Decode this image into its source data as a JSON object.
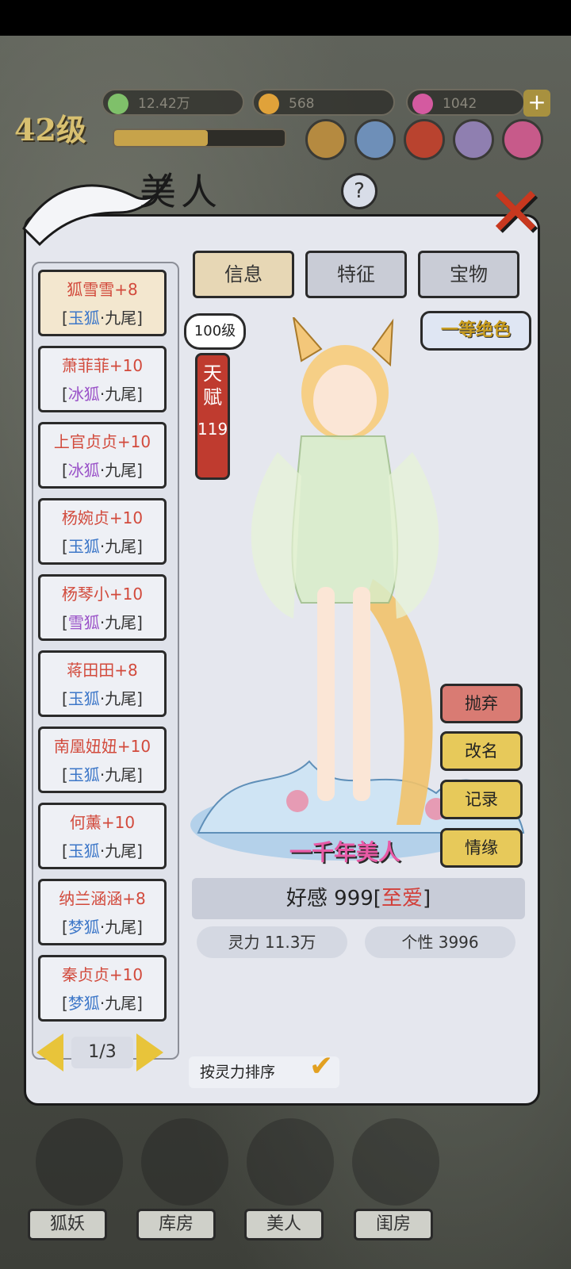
{
  "hud": {
    "level": "42级",
    "exp_progress": 0.55,
    "resources": [
      {
        "name": "spirit-stone",
        "value": "12.42万",
        "color": "#7fc06a"
      },
      {
        "name": "gold-coin",
        "value": "568",
        "color": "#e0a23a"
      },
      {
        "name": "gem",
        "value": "1042",
        "color": "#d45aa0"
      }
    ],
    "plus_label": "+"
  },
  "panel": {
    "title": "美人",
    "help_label": "?",
    "close_label": "✕"
  },
  "tabs": [
    {
      "label": "信息",
      "active": true
    },
    {
      "label": "特征",
      "active": false
    },
    {
      "label": "宝物",
      "active": false
    }
  ],
  "list": [
    {
      "name": "狐雪雪+8",
      "kind": "玉狐",
      "suffix": "·九尾]",
      "kind_color": "blue",
      "selected": true
    },
    {
      "name": "萧菲菲+10",
      "kind": "冰狐",
      "suffix": "·九尾]",
      "kind_color": "purple"
    },
    {
      "name": "上官贞贞+10",
      "kind": "冰狐",
      "suffix": "·九尾]",
      "kind_color": "purple"
    },
    {
      "name": "杨婉贞+10",
      "kind": "玉狐",
      "suffix": "·九尾]",
      "kind_color": "blue"
    },
    {
      "name": "杨琴小+10",
      "kind": "雪狐",
      "suffix": "·九尾]",
      "kind_color": "purple"
    },
    {
      "name": "蒋田田+8",
      "kind": "玉狐",
      "suffix": "·九尾]",
      "kind_color": "blue"
    },
    {
      "name": "南凰妞妞+10",
      "kind": "玉狐",
      "suffix": "·九尾]",
      "kind_color": "blue"
    },
    {
      "name": "何薰+10",
      "kind": "玉狐",
      "suffix": "·九尾]",
      "kind_color": "blue"
    },
    {
      "name": "纳兰涵涵+8",
      "kind": "梦狐",
      "suffix": "·九尾]",
      "kind_color": "blue"
    },
    {
      "name": "秦贞贞+10",
      "kind": "梦狐",
      "suffix": "·九尾]",
      "kind_color": "blue"
    }
  ],
  "pager": {
    "label": "1/3"
  },
  "character": {
    "level_badge": "100级",
    "talent_label": "天赋",
    "talent_value": "119",
    "grade": "一等绝色",
    "title_tag": "一千年美人",
    "favor_prefix": "好感 999[",
    "favor_love": "至爱",
    "favor_suffix": "]",
    "power": "灵力 11.3万",
    "personality": "个性 3996"
  },
  "actions": [
    "抛弃",
    "改名",
    "记录",
    "情缘"
  ],
  "sort_label": "按灵力排序",
  "bottom_nav": [
    "狐妖",
    "库房",
    "美人",
    "闺房"
  ]
}
